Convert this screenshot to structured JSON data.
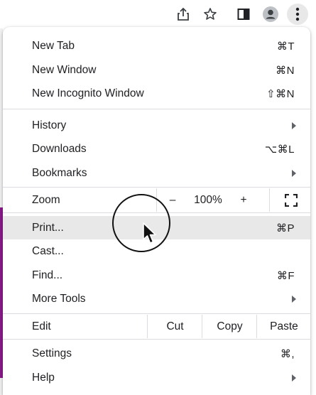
{
  "toolbar": {
    "icons": [
      "share-icon",
      "star-icon",
      "side-panel-icon",
      "profile-icon",
      "more-vert-icon"
    ]
  },
  "menu": {
    "new_tab": {
      "label": "New Tab",
      "shortcut": "⌘T"
    },
    "new_window": {
      "label": "New Window",
      "shortcut": "⌘N"
    },
    "new_incognito": {
      "label": "New Incognito Window",
      "shortcut": "⇧⌘N"
    },
    "history": {
      "label": "History"
    },
    "downloads": {
      "label": "Downloads",
      "shortcut": "⌥⌘L"
    },
    "bookmarks": {
      "label": "Bookmarks"
    },
    "zoom": {
      "label": "Zoom",
      "minus": "–",
      "value": "100%",
      "plus": "+"
    },
    "print": {
      "label": "Print...",
      "shortcut": "⌘P"
    },
    "cast": {
      "label": "Cast..."
    },
    "find": {
      "label": "Find...",
      "shortcut": "⌘F"
    },
    "more_tools": {
      "label": "More Tools"
    },
    "edit": {
      "label": "Edit",
      "cut": "Cut",
      "copy": "Copy",
      "paste": "Paste"
    },
    "settings": {
      "label": "Settings",
      "shortcut": "⌘,"
    },
    "help": {
      "label": "Help"
    }
  },
  "colors": {
    "highlight": "#e8e8e8",
    "separator": "#dadce0",
    "accent_strip": "#8a1a8c"
  }
}
